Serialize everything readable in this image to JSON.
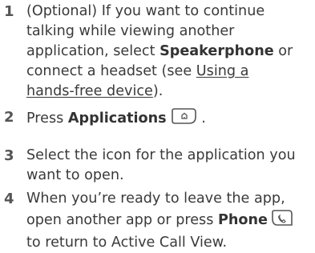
{
  "steps": [
    {
      "number": "1",
      "line1": "(Optional)  If you want to continue",
      "line2": "talking while viewing another",
      "line3_pre": "application, select ",
      "line3_bold": "Speakerphone",
      "line3_post": " or",
      "line4": "connect a headset (see ",
      "link_part1": "Using a ",
      "link_part2": "hands-free device",
      "line5_post": ")."
    },
    {
      "number": "2",
      "pre": "Press ",
      "bold": "Applications",
      "post": " .",
      "icon": "applications-key-icon"
    },
    {
      "number": "3",
      "line1": "Select the icon for the application you",
      "line2": "want to open."
    },
    {
      "number": "4",
      "line1": "When you’re ready to leave the app,",
      "line2_pre": "open another app or press ",
      "line2_bold": "Phone",
      "line3": "to return to Active Call View.",
      "icon": "phone-key-icon"
    }
  ]
}
